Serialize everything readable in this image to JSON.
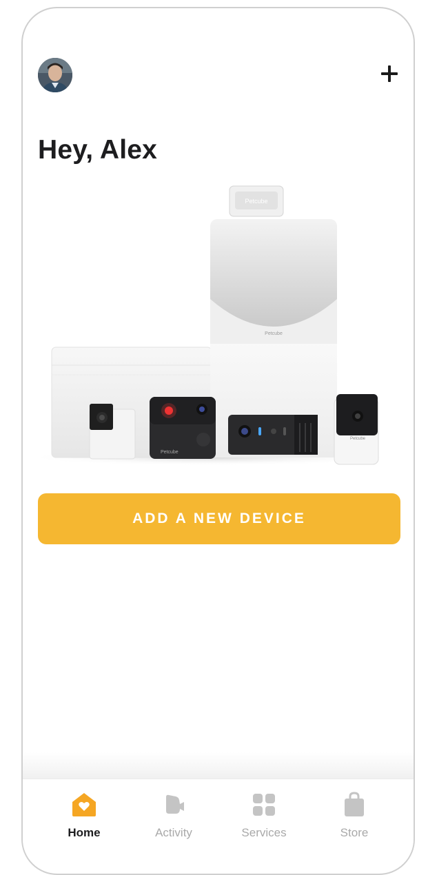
{
  "header": {
    "greeting": "Hey, Alex",
    "avatar_icon": "user-avatar",
    "add_icon": "plus-icon"
  },
  "hero": {
    "brand_top": "Petcube",
    "brand_small": "Petcube"
  },
  "cta": {
    "label": "ADD A NEW DEVICE",
    "color": "#f5b731"
  },
  "tabbar": {
    "active_color": "#f5a623",
    "inactive_color": "#c4c4c4",
    "tabs": [
      {
        "label": "Home",
        "icon": "home-icon",
        "active": true
      },
      {
        "label": "Activity",
        "icon": "activity-icon",
        "active": false
      },
      {
        "label": "Services",
        "icon": "services-icon",
        "active": false
      },
      {
        "label": "Store",
        "icon": "store-bag-icon",
        "active": false
      }
    ]
  }
}
